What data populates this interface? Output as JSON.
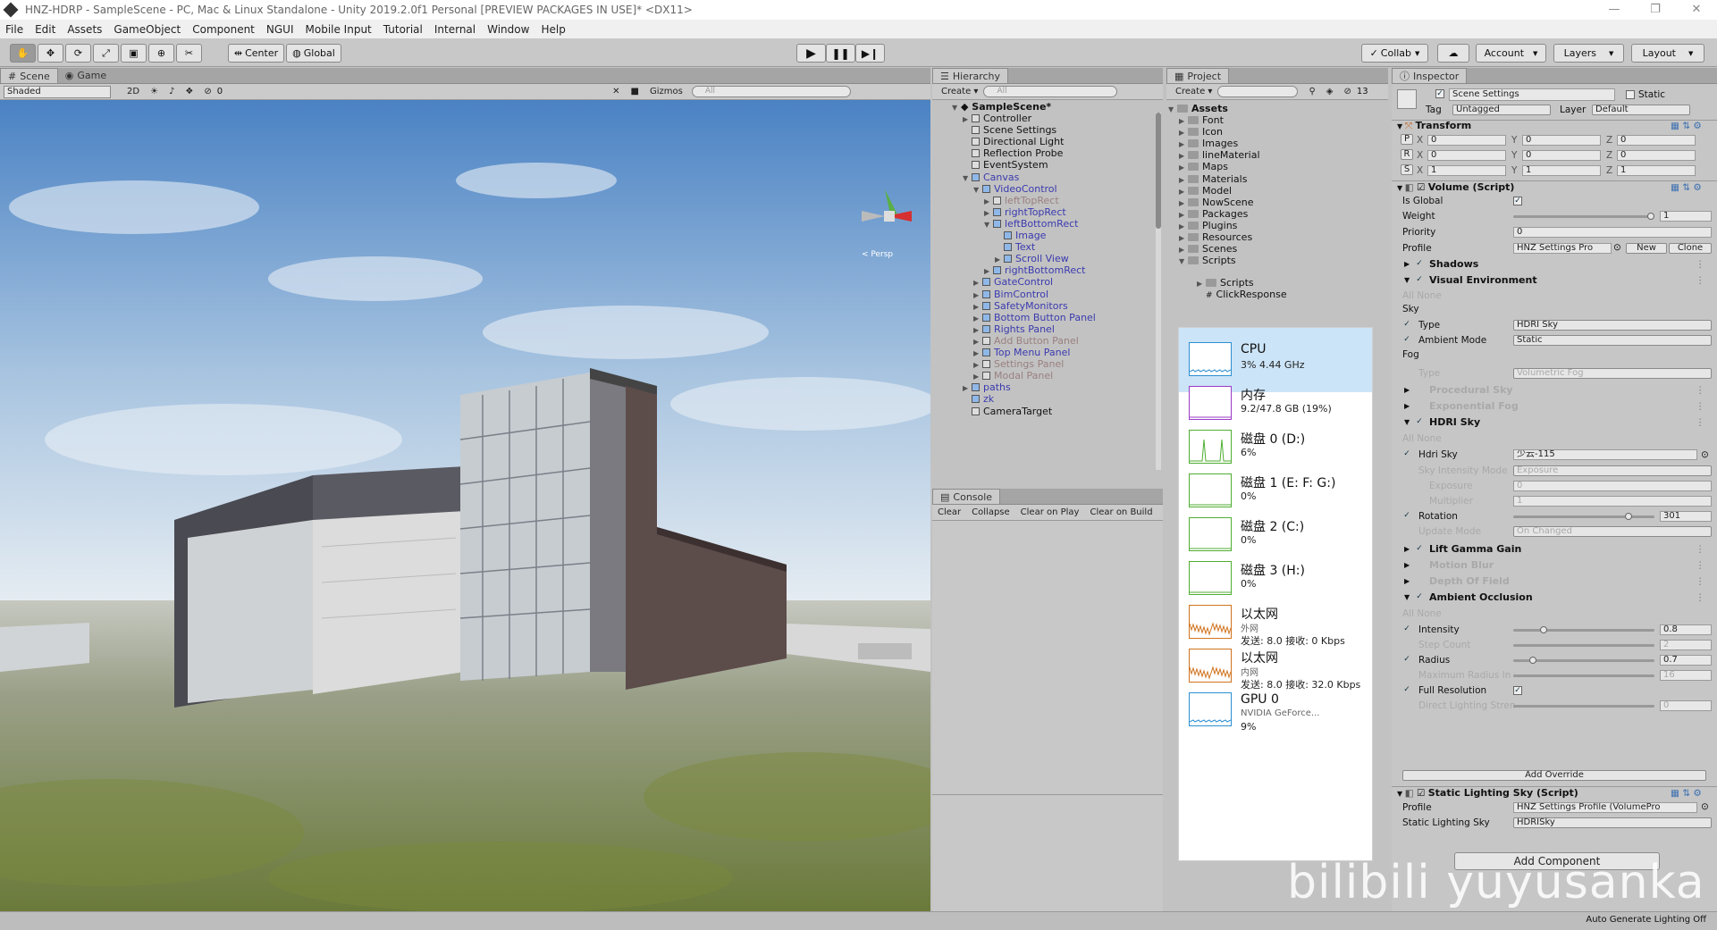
{
  "title": "HNZ-HDRP - SampleScene - PC, Mac & Linux Standalone - Unity 2019.2.0f1 Personal [PREVIEW PACKAGES IN USE]* <DX11>",
  "window_controls": [
    "—",
    "❐",
    "✕"
  ],
  "menu": [
    "File",
    "Edit",
    "Assets",
    "GameObject",
    "Component",
    "NGUI",
    "Mobile Input",
    "Tutorial",
    "Internal",
    "Window",
    "Help"
  ],
  "toolbar": {
    "pivot": "Center",
    "space": "Global",
    "collab": "Collab",
    "account": "Account",
    "layers": "Layers",
    "layout": "Layout"
  },
  "scene": {
    "tabs": [
      "Scene",
      "Game"
    ],
    "shading": "Shaded",
    "mode2d": "2D",
    "fx_count": "0",
    "gizmos": "Gizmos",
    "search": "All",
    "persp": "< Persp"
  },
  "hierarchy": {
    "tab": "Hierarchy",
    "create": "Create",
    "search": "All",
    "scene": "SampleScene*",
    "items": [
      {
        "label": "Controller",
        "depth": 1,
        "arrow": "▶",
        "cls": ""
      },
      {
        "label": "Scene Settings",
        "depth": 1,
        "arrow": "",
        "cls": ""
      },
      {
        "label": "Directional Light",
        "depth": 1,
        "arrow": "",
        "cls": ""
      },
      {
        "label": "Reflection Probe",
        "depth": 1,
        "arrow": "",
        "cls": ""
      },
      {
        "label": "EventSystem",
        "depth": 1,
        "arrow": "",
        "cls": ""
      },
      {
        "label": "Canvas",
        "depth": 1,
        "arrow": "▼",
        "cls": "prefab"
      },
      {
        "label": "VideoControl",
        "depth": 2,
        "arrow": "▼",
        "cls": "prefab"
      },
      {
        "label": "leftTopRect",
        "depth": 3,
        "arrow": "▶",
        "cls": "dim"
      },
      {
        "label": "rightTopRect",
        "depth": 3,
        "arrow": "▶",
        "cls": "prefab"
      },
      {
        "label": "leftBottomRect",
        "depth": 3,
        "arrow": "▼",
        "cls": "prefab"
      },
      {
        "label": "Image",
        "depth": 4,
        "arrow": "",
        "cls": "prefab"
      },
      {
        "label": "Text",
        "depth": 4,
        "arrow": "",
        "cls": "prefab"
      },
      {
        "label": "Scroll View",
        "depth": 4,
        "arrow": "▶",
        "cls": "prefab"
      },
      {
        "label": "rightBottomRect",
        "depth": 3,
        "arrow": "▶",
        "cls": "prefab"
      },
      {
        "label": "GateControl",
        "depth": 2,
        "arrow": "▶",
        "cls": "prefab"
      },
      {
        "label": "BimControl",
        "depth": 2,
        "arrow": "▶",
        "cls": "prefab"
      },
      {
        "label": "SafetyMonitors",
        "depth": 2,
        "arrow": "▶",
        "cls": "prefab"
      },
      {
        "label": "Bottom Button Panel",
        "depth": 2,
        "arrow": "▶",
        "cls": "prefab"
      },
      {
        "label": "Rights Panel",
        "depth": 2,
        "arrow": "▶",
        "cls": "prefab"
      },
      {
        "label": "Add Button Panel",
        "depth": 2,
        "arrow": "▶",
        "cls": "dim"
      },
      {
        "label": "Top Menu Panel",
        "depth": 2,
        "arrow": "▶",
        "cls": "prefab"
      },
      {
        "label": "Settings Panel",
        "depth": 2,
        "arrow": "▶",
        "cls": "dim"
      },
      {
        "label": "Modal Panel",
        "depth": 2,
        "arrow": "▶",
        "cls": "dim"
      },
      {
        "label": "paths",
        "depth": 1,
        "arrow": "▶",
        "cls": "prefab"
      },
      {
        "label": "zk",
        "depth": 1,
        "arrow": "",
        "cls": "prefab"
      },
      {
        "label": "CameraTarget",
        "depth": 1,
        "arrow": "",
        "cls": ""
      }
    ]
  },
  "console": {
    "tab": "Console",
    "buttons": [
      "Clear",
      "Collapse",
      "Clear on Play",
      "Clear on Build"
    ]
  },
  "project": {
    "tab": "Project",
    "create": "Create",
    "count": "13",
    "root": "Assets",
    "folders": [
      "Font",
      "Icon",
      "Images",
      "lineMaterial",
      "Maps",
      "Materials",
      "Model",
      "NowScene",
      "Packages",
      "Plugins",
      "Resources",
      "Scenes",
      "Scripts"
    ],
    "sub_folder": "Scripts",
    "sub_item": "ClickResponse"
  },
  "perf": {
    "items": [
      {
        "title": "CPU",
        "sub": "3% 4.44 GHz",
        "sub2": "",
        "color": "#2c8fd1"
      },
      {
        "title": "内存",
        "sub": "9.2/47.8 GB (19%)",
        "sub2": "",
        "color": "#9b3bc6"
      },
      {
        "title": "磁盘 0 (D:)",
        "sub": "6%",
        "sub2": "",
        "color": "#4fae32"
      },
      {
        "title": "磁盘 1 (E: F: G:)",
        "sub": "0%",
        "sub2": "",
        "color": "#4fae32"
      },
      {
        "title": "磁盘 2 (C:)",
        "sub": "0%",
        "sub2": "",
        "color": "#4fae32"
      },
      {
        "title": "磁盘 3 (H:)",
        "sub": "0%",
        "sub2": "",
        "color": "#4fae32"
      },
      {
        "title": "以太网",
        "sub2": "外网",
        "sub": "发送: 8.0 接收: 0 Kbps",
        "color": "#d0731e"
      },
      {
        "title": "以太网",
        "sub2": "内网",
        "sub": "发送: 8.0 接收: 32.0 Kbps",
        "color": "#d0731e"
      },
      {
        "title": "GPU 0",
        "sub2": "NVIDIA GeForce...",
        "sub": "9%",
        "color": "#2c8fd1"
      }
    ]
  },
  "inspector": {
    "tab": "Inspector",
    "object_name": "Scene Settings",
    "static": "Static",
    "tag_label": "Tag",
    "tag": "Untagged",
    "layer_label": "Layer",
    "layer": "Default",
    "transform": "Transform",
    "pos": [
      "0",
      "0",
      "0"
    ],
    "rot": [
      "0",
      "0",
      "0"
    ],
    "scale": [
      "1",
      "1",
      "1"
    ],
    "xyz": [
      "X",
      "Y",
      "Z"
    ],
    "prs": [
      "P",
      "R",
      "S"
    ],
    "volume": "Volume (Script)",
    "is_global": "Is Global",
    "weight": "Weight",
    "weight_val": "1",
    "priority": "Priority",
    "priority_val": "0",
    "profile": "Profile",
    "profile_val": "HNZ Settings Pro",
    "new": "New",
    "clone": "Clone",
    "shadows": "Shadows",
    "visual_env": "Visual Environment",
    "all_none": "All  None",
    "sky": "Sky",
    "type": "Type",
    "type_val": "HDRI Sky",
    "ambient_mode": "Ambient Mode",
    "ambient_val": "Static",
    "fog": "Fog",
    "fog_type": "Type",
    "fog_type_val": "Volumetric Fog",
    "procedural_sky": "Procedural Sky",
    "exp_fog": "Exponential Fog",
    "hdri_sky": "HDRI Sky",
    "hdri_sky_field": "Hdri Sky",
    "hdri_val": "少云-115",
    "sky_int_mode": "Sky Intensity Mode",
    "sky_int_val": "Exposure",
    "exposure": "Exposure",
    "exposure_val": "0",
    "multiplier": "Multiplier",
    "multiplier_val": "1",
    "rotation": "Rotation",
    "rotation_val": "301",
    "rotation_level": 0.836,
    "update_mode": "Update Mode",
    "update_val": "On Changed",
    "lift_gamma": "Lift Gamma Gain",
    "motion_blur": "Motion Blur",
    "dof": "Depth Of Field",
    "ao": "Ambient Occlusion",
    "intensity": "Intensity",
    "intensity_val": "0.8",
    "intensity_level": 0.2,
    "step_count": "Step Count",
    "step_val": "2",
    "radius": "Radius",
    "radius_val": "0.7",
    "radius_level": 0.12,
    "max_radius": "Maximum Radius In P",
    "max_radius_val": "16",
    "full_res": "Full Resolution",
    "direct_light": "Direct Lighting Streng",
    "direct_val": "0",
    "add_override": "Add Override",
    "static_sky": "Static Lighting Sky (Script)",
    "static_profile": "Profile",
    "static_profile_val": "HNZ Settings Profile (VolumePro",
    "static_sky_field": "Static Lighting Sky",
    "static_sky_val": "HDRISky",
    "add_component": "Add Component",
    "auto_gen": "Auto Generate Lighting Off"
  },
  "watermark": "bilibili yuyusanka"
}
